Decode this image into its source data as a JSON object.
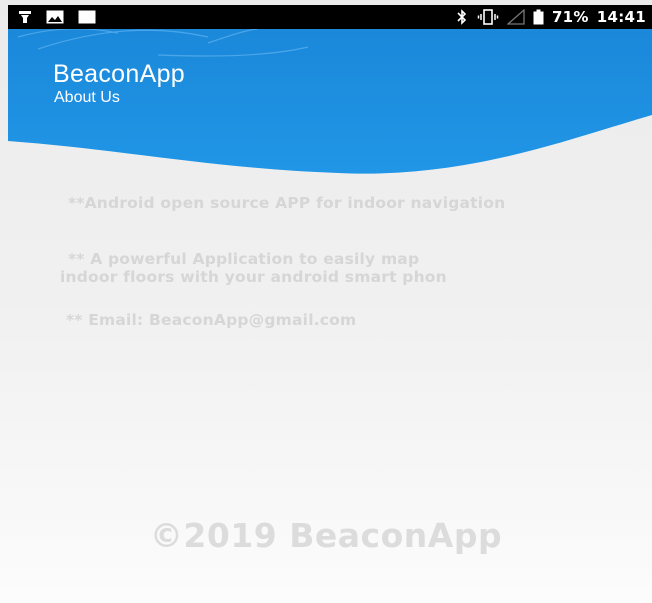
{
  "status_bar": {
    "left_icons": [
      "flashlight-icon",
      "image-icon",
      "window-icon"
    ],
    "right_icons": [
      "bluetooth-icon",
      "vibrate-icon",
      "signal-icon",
      "battery-icon"
    ],
    "battery": "71%",
    "time": "14:41"
  },
  "header": {
    "title": "BeaconApp",
    "subtitle": "About Us",
    "color": "#1e8fe0"
  },
  "content": {
    "line1": "**Android open source APP for indoor navigation",
    "line2a": "** A powerful Application to easily map",
    "line2b": "indoor floors with your android smart phon",
    "line3": "** Email: BeaconApp@gmail.com"
  },
  "footer": {
    "copyright": "©2019 BeaconApp"
  }
}
